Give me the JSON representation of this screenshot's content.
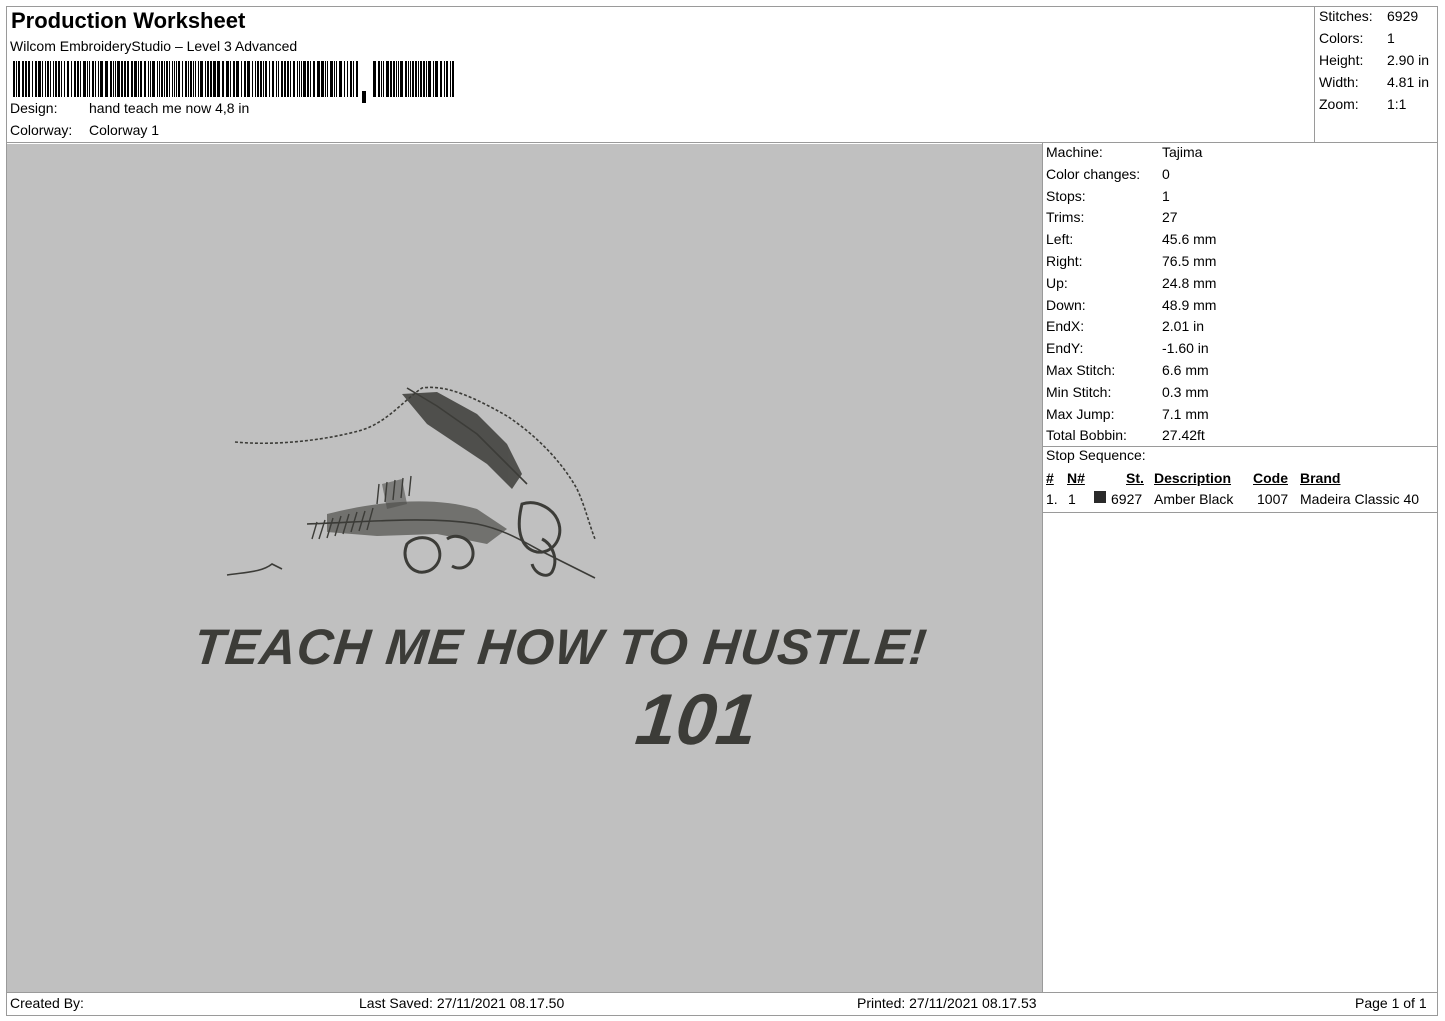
{
  "header": {
    "title": "Production Worksheet",
    "subtitle": "Wilcom EmbroideryStudio – Level 3 Advanced",
    "design_label": "Design:",
    "design_value": "hand teach me now 4,8 in",
    "colorway_label": "Colorway:",
    "colorway_value": "Colorway 1"
  },
  "stats": [
    {
      "label": "Stitches:",
      "value": "6929"
    },
    {
      "label": "Colors:",
      "value": "1"
    },
    {
      "label": "Height:",
      "value": "2.90 in"
    },
    {
      "label": "Width:",
      "value": "4.81 in"
    },
    {
      "label": "Zoom:",
      "value": "1:1"
    }
  ],
  "properties": [
    {
      "label": "Machine:",
      "value": "Tajima"
    },
    {
      "label": "Color changes:",
      "value": "0"
    },
    {
      "label": "Stops:",
      "value": "1"
    },
    {
      "label": "Trims:",
      "value": "27"
    },
    {
      "label": "Left:",
      "value": "45.6 mm"
    },
    {
      "label": "Right:",
      "value": "76.5 mm"
    },
    {
      "label": "Up:",
      "value": "24.8 mm"
    },
    {
      "label": "Down:",
      "value": "48.9 mm"
    },
    {
      "label": "EndX:",
      "value": "2.01 in"
    },
    {
      "label": "EndY:",
      "value": "-1.60 in"
    },
    {
      "label": "Max Stitch:",
      "value": "6.6 mm"
    },
    {
      "label": "Min Stitch:",
      "value": "0.3 mm"
    },
    {
      "label": "Max Jump:",
      "value": "7.1 mm"
    },
    {
      "label": "Total Bobbin:",
      "value": "27.42ft"
    }
  ],
  "stop_sequence": {
    "title": "Stop Sequence:",
    "headers": {
      "num": "#",
      "n_num": "N#",
      "st": "St.",
      "description": "Description",
      "code": "Code",
      "brand": "Brand"
    },
    "rows": [
      {
        "num": "1.",
        "n_num": "1",
        "swatch_color": "#2a2a2a",
        "st": "6927",
        "description": "Amber Black",
        "code": "1007",
        "brand": "Madeira Classic 40"
      }
    ]
  },
  "design": {
    "text_line1": "TEACH ME HOW TO HUSTLE!",
    "text_line2": "101",
    "thread_color": "#3c3c38",
    "background_color": "#c0c0c0"
  },
  "footer": {
    "created_by": "Created By:",
    "last_saved": "Last Saved: 27/11/2021 08.17.50",
    "printed": "Printed: 27/11/2021 08.17.53",
    "page": "Page 1 of 1"
  }
}
